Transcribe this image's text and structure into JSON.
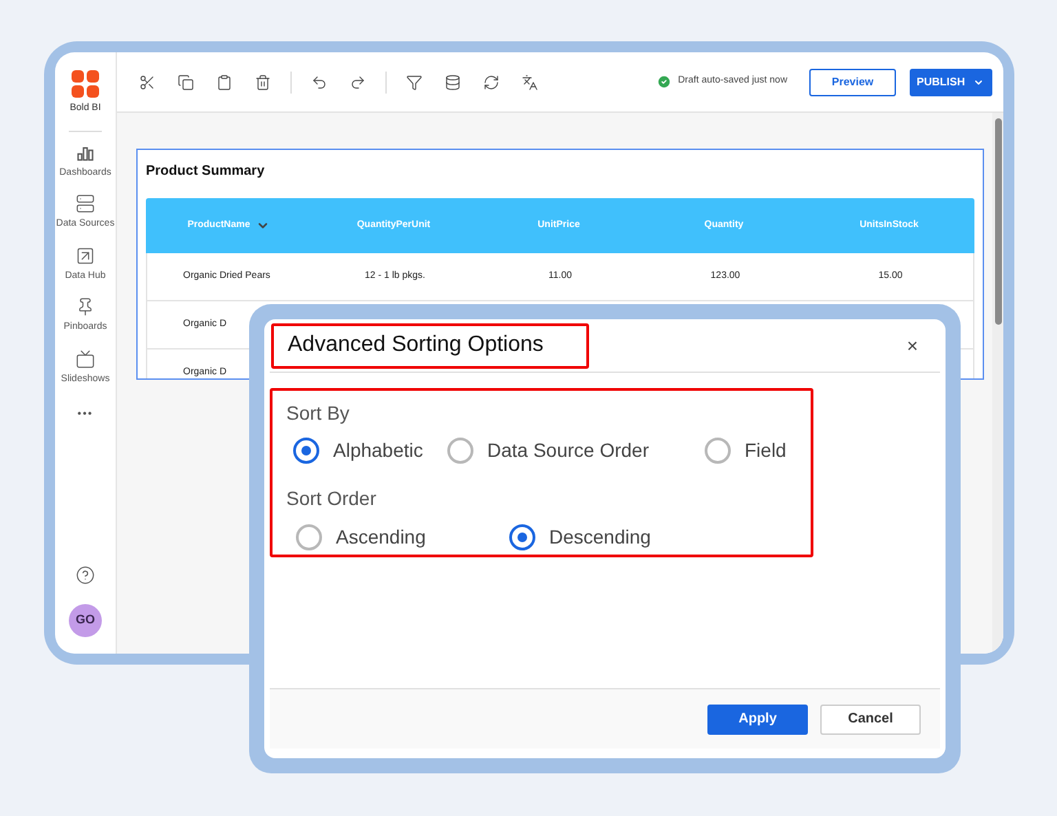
{
  "app": {
    "logo_text": "Bold BI",
    "avatar": "GO"
  },
  "sidebar": {
    "items": [
      {
        "label": "Dashboards",
        "kind": "dashboards"
      },
      {
        "label": "Data Sources",
        "kind": "sources"
      },
      {
        "label": "Data Hub",
        "kind": "hub"
      },
      {
        "label": "Pinboards",
        "kind": "pin"
      },
      {
        "label": "Slideshows",
        "kind": "slides"
      }
    ],
    "more": "•••"
  },
  "toolbar": {
    "status": "Draft auto-saved just now",
    "preview": "Preview",
    "publish": "PUBLISH"
  },
  "widget": {
    "title": "Product Summary",
    "columns": [
      {
        "label": "ProductName",
        "sorted": true
      },
      {
        "label": "QuantityPerUnit",
        "sorted": false
      },
      {
        "label": "UnitPrice",
        "sorted": false
      },
      {
        "label": "Quantity",
        "sorted": false
      },
      {
        "label": "UnitsInStock",
        "sorted": false
      }
    ],
    "rows": [
      [
        "Organic Dried Pears",
        "12 - 1 lb pkgs.",
        "11.00",
        "123.00",
        "15.00"
      ],
      [
        "Organic D"
      ],
      [
        "Organic D"
      ]
    ]
  },
  "dialog": {
    "title": "Advanced Sorting Options",
    "close": "×",
    "sort_by": {
      "label": "Sort By",
      "options": [
        {
          "label": "Alphabetic",
          "selected": true
        },
        {
          "label": "Data Source Order",
          "selected": false
        },
        {
          "label": "Field",
          "selected": false
        }
      ]
    },
    "sort_order": {
      "label": "Sort Order",
      "options": [
        {
          "label": "Ascending",
          "selected": false
        },
        {
          "label": "Descending",
          "selected": true
        }
      ]
    },
    "buttons": [
      {
        "label": "Apply",
        "kind": "primary"
      },
      {
        "label": "Cancel",
        "kind": "secondary"
      }
    ]
  }
}
